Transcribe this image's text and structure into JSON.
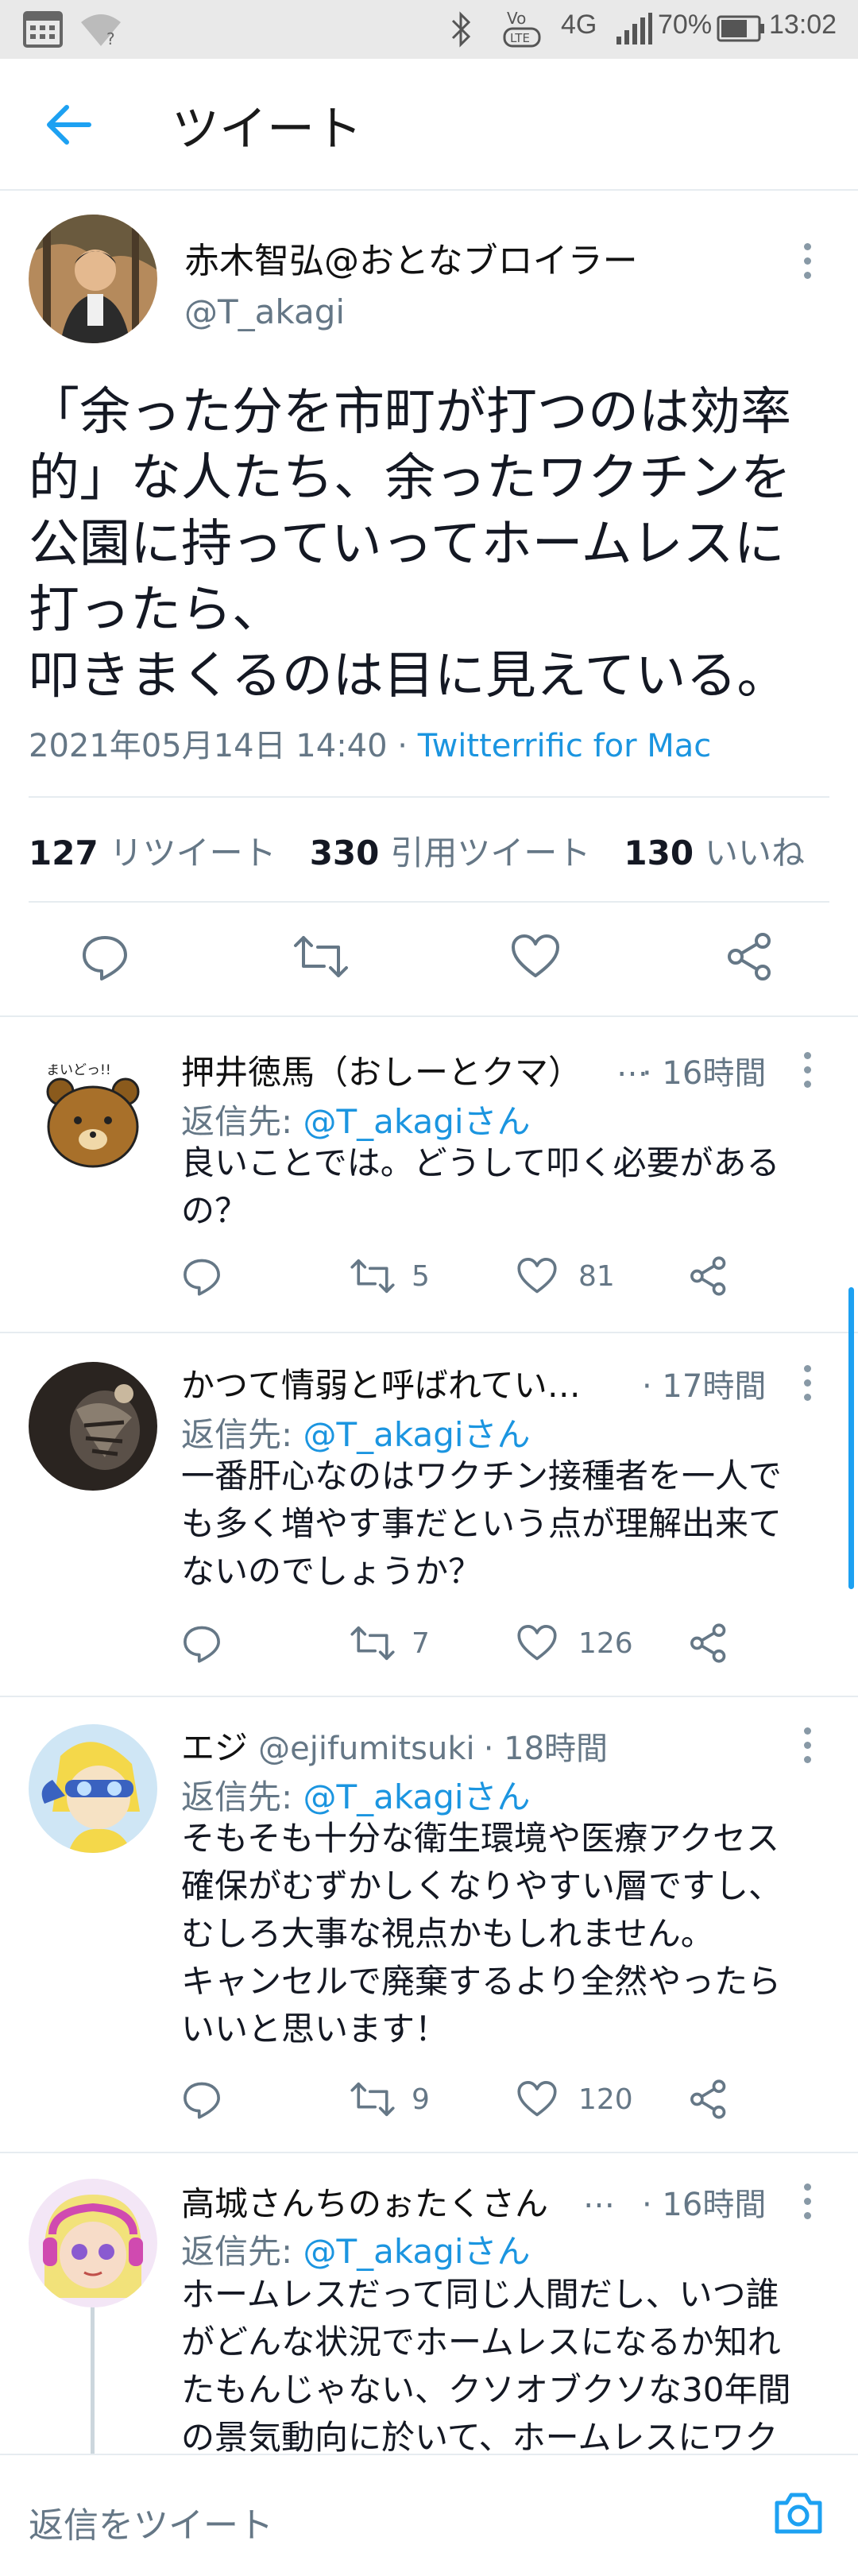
{
  "status_bar": {
    "network": "4G",
    "battery": "70%",
    "time": "13:02"
  },
  "header": {
    "title": "ツイート"
  },
  "tweet": {
    "author_name": "赤木智弘@おとなブロイラー",
    "author_handle": "@T_akagi",
    "text_lines": [
      "「余った分を市町が打つのは効率",
      "的」な人たち、余ったワクチンを",
      "公園に持っていってホームレスに",
      "打ったら、",
      "叩きまくるのは目に見えている。"
    ],
    "timestamp": "2021年05月14日 14:40",
    "separator": " · ",
    "client": "Twitterrific for Mac",
    "retweets_count": "127",
    "retweets_label": "リツイート",
    "quotes_count": "330",
    "quotes_label": "引用ツイート",
    "likes_count": "130",
    "likes_label": "いいね"
  },
  "replies": [
    {
      "name": "押井徳馬（おしーとクマ）",
      "handle": "",
      "ellipsis": "…",
      "time": "· 16時間",
      "reply_prefix": "返信先: ",
      "reply_to": "@T_akagiさん",
      "text_lines": [
        "良いことでは。どうして叩く必要がある",
        "の？"
      ],
      "retweets": "5",
      "likes": "81",
      "avatar_text": "まいどっ!!"
    },
    {
      "name": "かつて情弱と呼ばれてい…",
      "handle": "",
      "ellipsis": "",
      "time": "· 17時間",
      "reply_prefix": "返信先: ",
      "reply_to": "@T_akagiさん",
      "text_lines": [
        "一番肝心なのはワクチン接種者を一人で",
        "も多く増やす事だという点が理解出来て",
        "ないのでしょうか？"
      ],
      "retweets": "7",
      "likes": "126"
    },
    {
      "name": "エジ",
      "handle": "@ejifumitsuki",
      "ellipsis": "",
      "time": "· 18時間",
      "reply_prefix": "返信先: ",
      "reply_to": "@T_akagiさん",
      "text_lines": [
        "そもそも十分な衛生環境や医療アクセス",
        "確保がむずかしくなりやすい層ですし、",
        "むしろ大事な視点かもしれません。",
        "キャンセルで廃棄するより全然やったら",
        "いいと思います！"
      ],
      "retweets": "9",
      "likes": "120"
    },
    {
      "name": "高城さんちのぉたくさん",
      "handle": "",
      "ellipsis": "…",
      "time": "· 16時間",
      "reply_prefix": "返信先: ",
      "reply_to": "@T_akagiさん",
      "text_lines": [
        "ホームレスだって同じ人間だし、いつ誰",
        "がどんな状況でホームレスになるか知れ",
        "たもんじゃない、クソオブクソな30年間",
        "の景気動向に於いて、ホームレスにワク"
      ],
      "retweets": "",
      "likes": ""
    }
  ],
  "composer": {
    "placeholder": "返信をツイート"
  },
  "colors": {
    "accent": "#1da1f2",
    "secondary_text": "#657786",
    "primary_text": "#141823",
    "status_bar_bg": "#e9e9e9"
  },
  "icons": [
    "calendar-icon",
    "wifi-icon",
    "bluetooth-icon",
    "volte-icon",
    "signal-icon",
    "battery-icon",
    "back-arrow-icon",
    "more-icon",
    "reply-icon",
    "retweet-icon",
    "like-icon",
    "share-icon",
    "camera-icon"
  ]
}
